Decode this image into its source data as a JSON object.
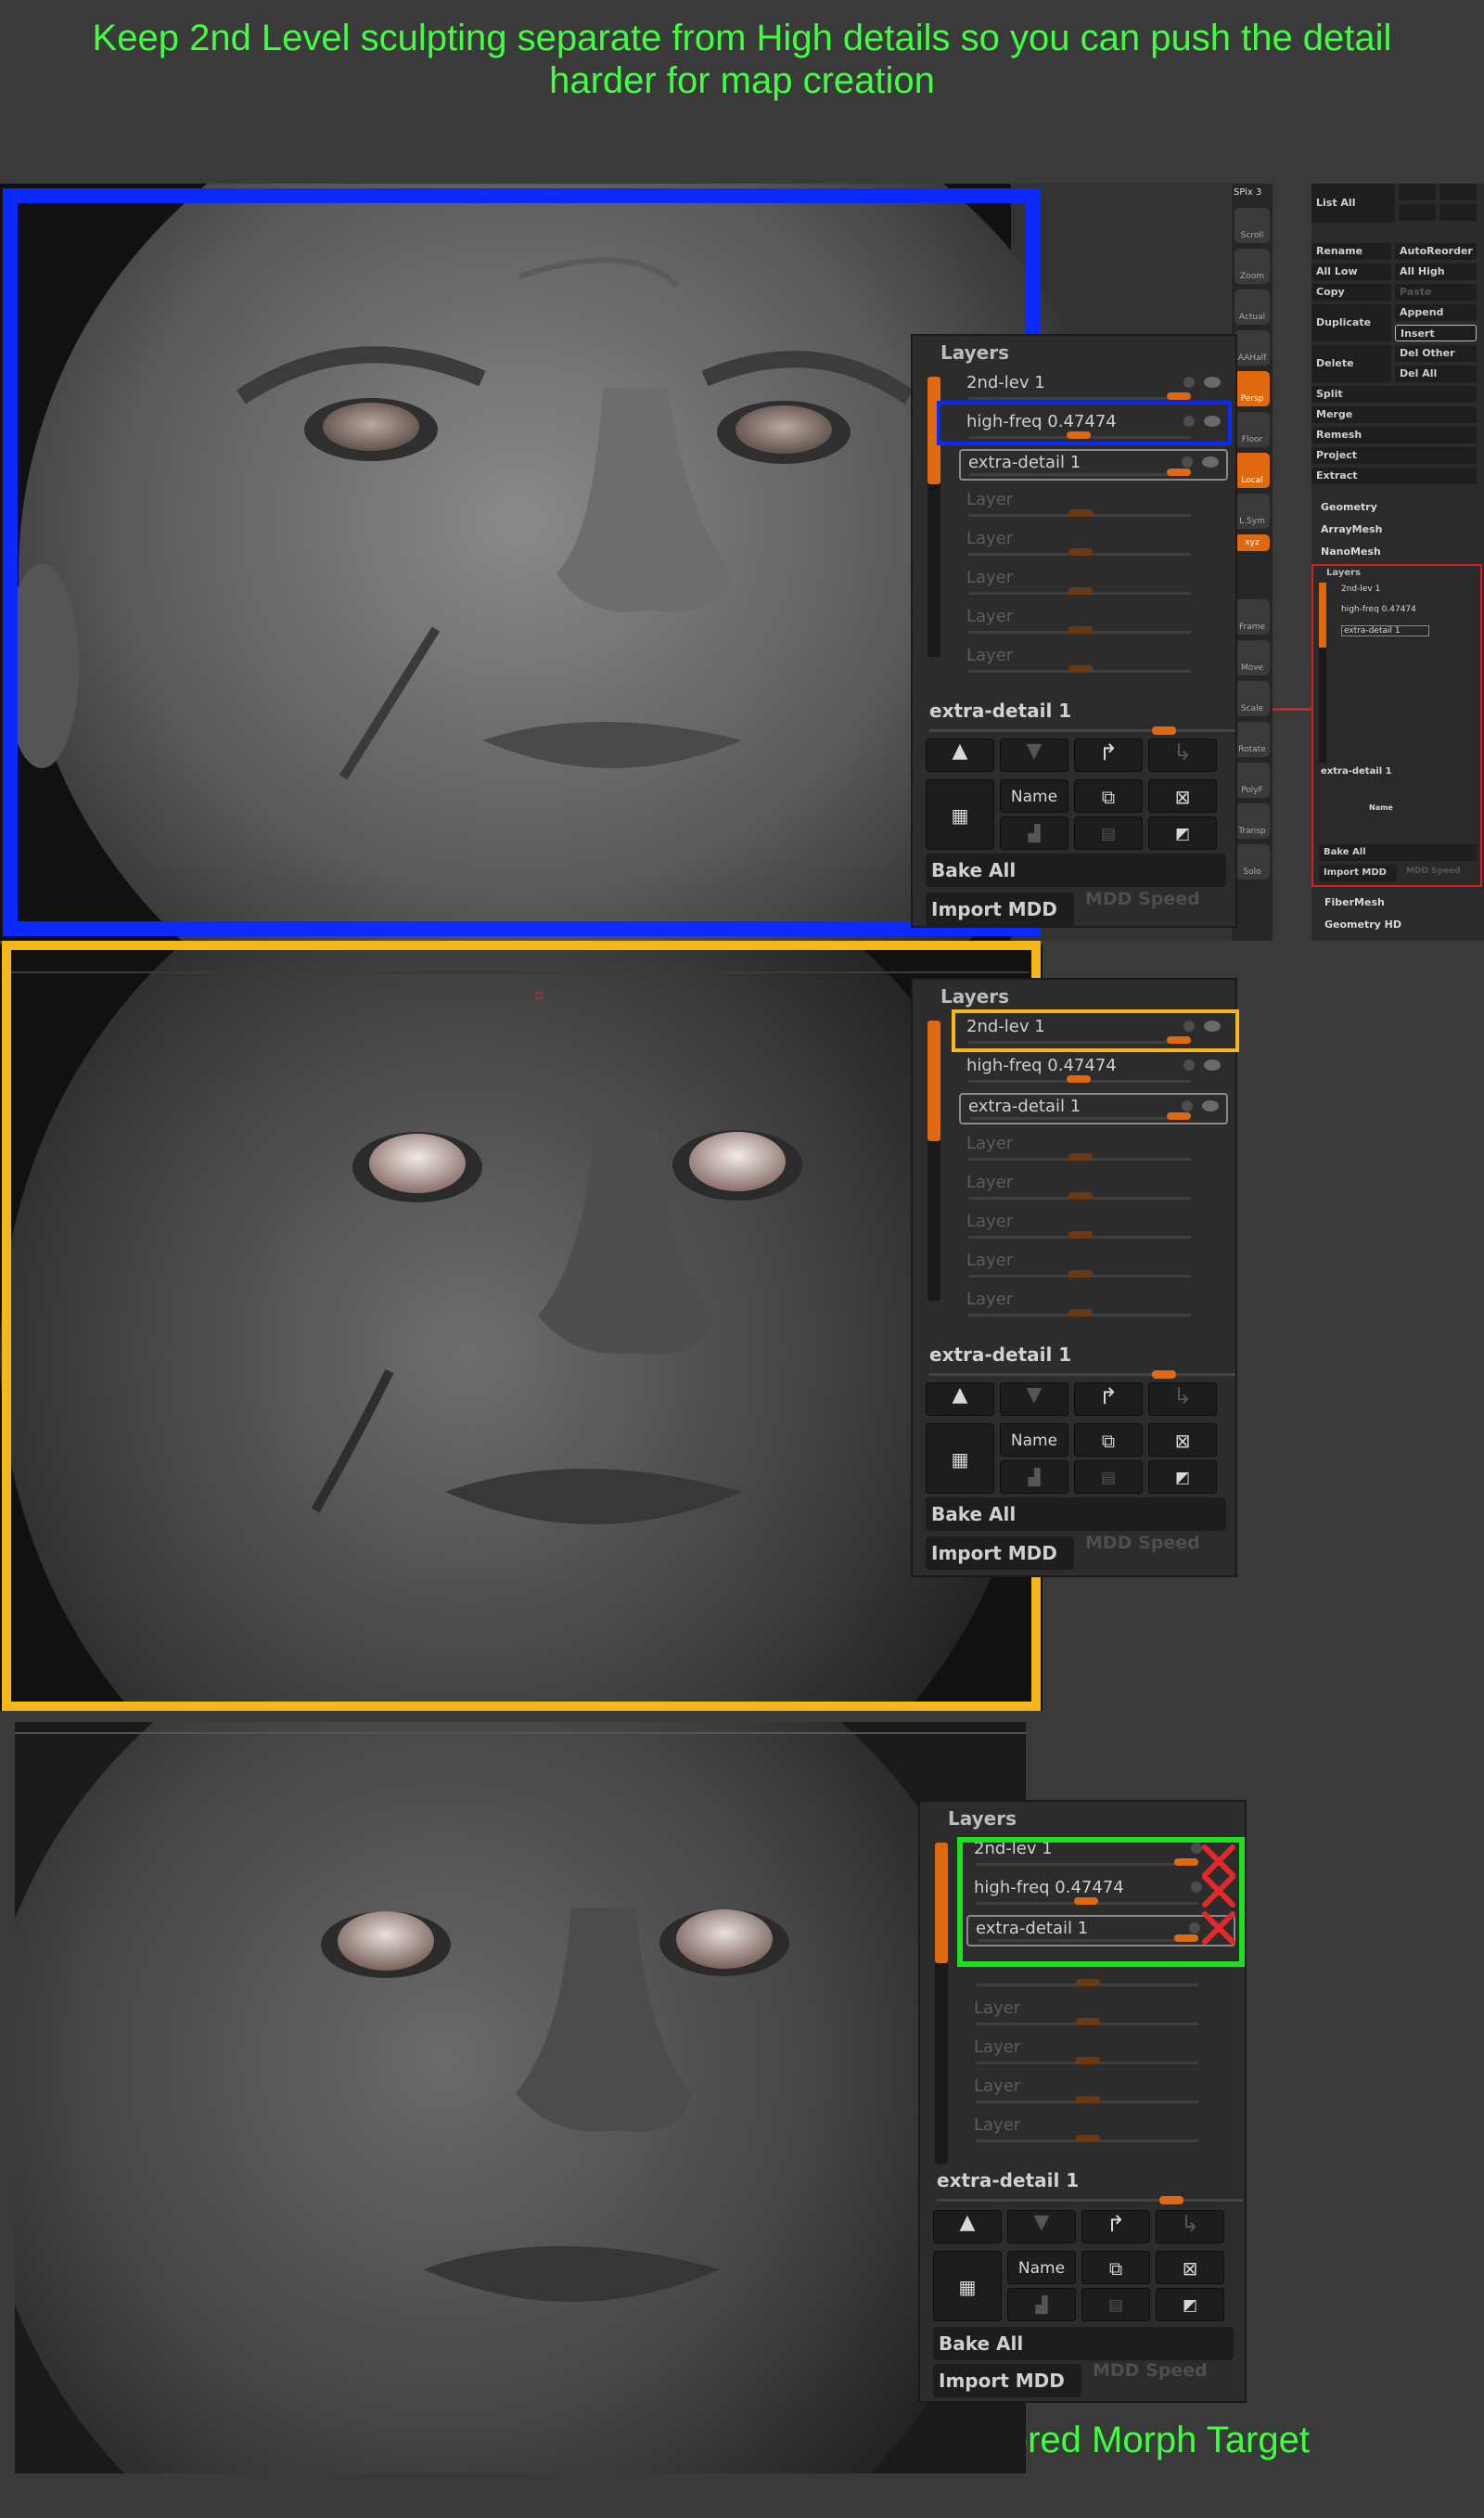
{
  "captions": {
    "top": "Keep 2nd Level sculpting separate from High details so you can push the detail harder for map creation",
    "bottom": "Stored Morph Target"
  },
  "colors": {
    "caption_green": "#3fff3f",
    "frame_blue": "#0a2aff",
    "frame_yellow": "#f5b719",
    "frame_green": "#1fe01f",
    "frame_red": "#d42020",
    "accent_orange": "#e0690f"
  },
  "panels": [
    {
      "title": "Layers",
      "layers": [
        {
          "name": "2nd-lev 1",
          "knob": 0.86
        },
        {
          "name": "high-freq 0.47474",
          "knob": 0.47
        },
        {
          "name": "extra-detail 1",
          "knob": 0.86
        }
      ],
      "empty_layer_label": "Layer",
      "empty_layer_count": 5,
      "selected_layer_label": "extra-detail 1",
      "name_button": "Name",
      "bake_all": "Bake All",
      "import_mdd": "Import MDD",
      "mdd_speed": "MDD Speed"
    },
    {
      "title": "Layers",
      "layers": [
        {
          "name": "2nd-lev 1",
          "knob": 0.86
        },
        {
          "name": "high-freq 0.47474",
          "knob": 0.47
        },
        {
          "name": "extra-detail 1",
          "knob": 0.86
        }
      ],
      "empty_layer_label": "Layer",
      "empty_layer_count": 5,
      "selected_layer_label": "extra-detail 1",
      "name_button": "Name",
      "bake_all": "Bake All",
      "import_mdd": "Import MDD",
      "mdd_speed": "MDD Speed"
    },
    {
      "title": "Layers",
      "layers": [
        {
          "name": "2nd-lev 1",
          "knob": 0.86
        },
        {
          "name": "high-freq 0.47474",
          "knob": 0.47
        },
        {
          "name": "extra-detail 1",
          "knob": 0.86
        }
      ],
      "empty_layer_label": "Layer",
      "empty_layer_count": 4,
      "selected_layer_label": "extra-detail 1",
      "name_button": "Name",
      "bake_all": "Bake All",
      "import_mdd": "Import MDD",
      "mdd_speed": "MDD Speed"
    }
  ],
  "toolbar": {
    "spix": "SPix 3",
    "buttons": [
      "Scroll",
      "Zoom",
      "Actual",
      "AAHalf",
      "Persp",
      "Floor",
      "Local",
      "L.Sym",
      "xyz",
      "Frame",
      "Move",
      "Scale",
      "Rotate",
      "PolyF",
      "Transp",
      "Solo"
    ]
  },
  "subtool_menu": {
    "list_all": "List All",
    "rename": "Rename",
    "auto_reorder": "AutoReorder",
    "all_low": "All Low",
    "all_high": "All High",
    "copy": "Copy",
    "paste": "Paste",
    "duplicate": "Duplicate",
    "append": "Append",
    "insert": "Insert",
    "delete": "Delete",
    "del_other": "Del Other",
    "del_all": "Del All",
    "split": "Split",
    "merge": "Merge",
    "remesh": "Remesh",
    "project": "Project",
    "extract": "Extract",
    "geometry": "Geometry",
    "arraymesh": "ArrayMesh",
    "nanomesh": "NanoMesh",
    "mini_layers_title": "Layers",
    "mini_layers": [
      "2nd-lev 1",
      "high-freq 0.47474",
      "extra-detail 1"
    ],
    "mini_selected": "extra-detail 1",
    "mini_name": "Name",
    "mini_bake_all": "Bake All",
    "mini_import_mdd": "Import MDD",
    "mini_mdd_speed": "MDD Speed",
    "fibermesh": "FiberMesh",
    "geometry_hd": "Geometry HD"
  }
}
